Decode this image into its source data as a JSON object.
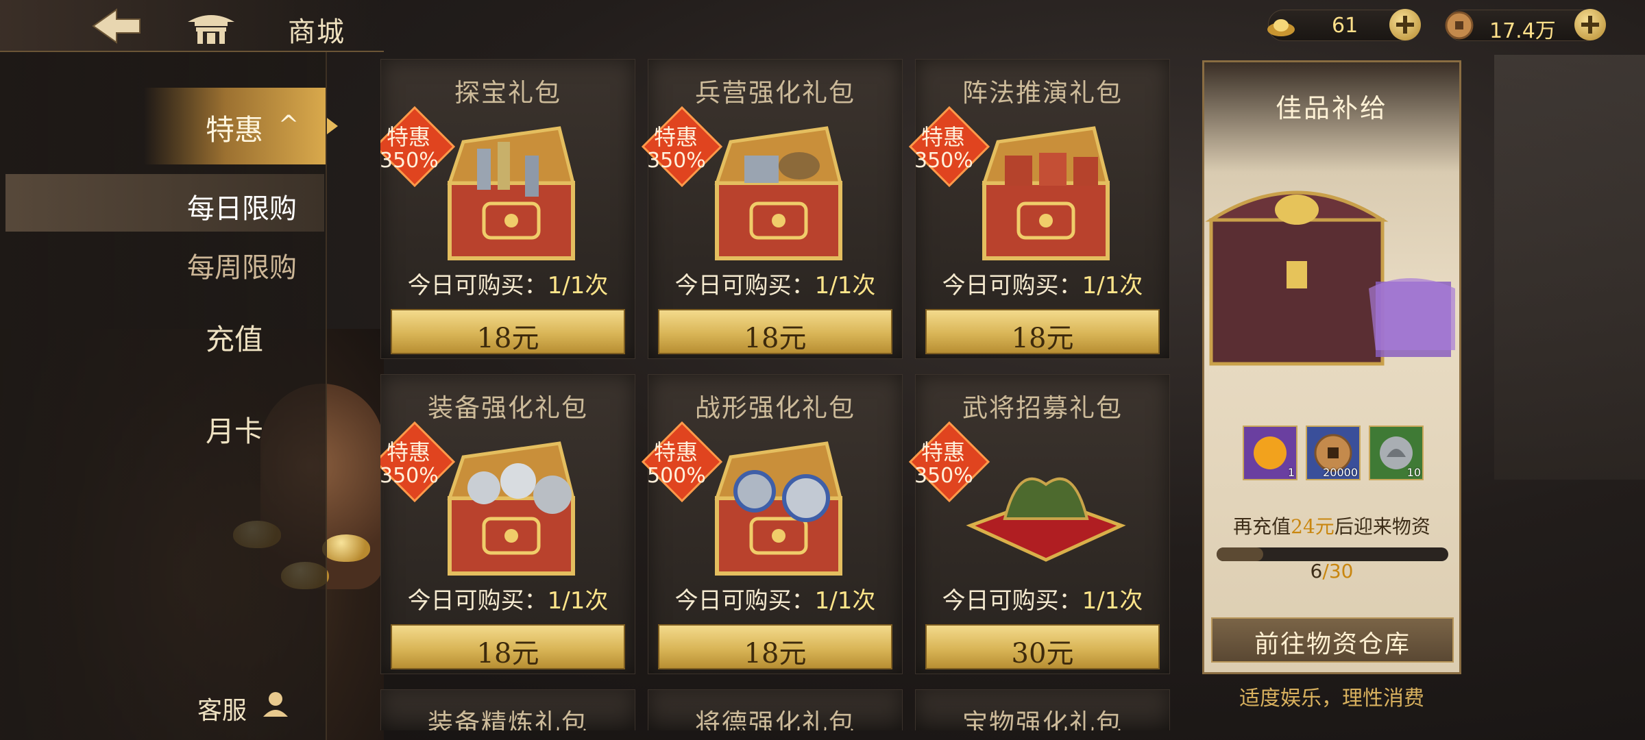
{
  "header": {
    "title": "商城",
    "gold_ingot": "61",
    "copper_coins": "17.4万"
  },
  "sidebar": {
    "category": "特惠",
    "category_chevron": "^",
    "subitems": [
      {
        "label": "每日限购",
        "active": true
      },
      {
        "label": "每周限购",
        "active": false
      }
    ],
    "items": [
      {
        "label": "充值"
      },
      {
        "label": "月卡"
      }
    ],
    "service": "客服"
  },
  "deal_tag": "特惠",
  "products": [
    {
      "name": "探宝礼包",
      "bonus": "350%",
      "limit_label": "今日可购买：",
      "limit_count": "1/1次",
      "price": "18元"
    },
    {
      "name": "兵营强化礼包",
      "bonus": "350%",
      "limit_label": "今日可购买：",
      "limit_count": "1/1次",
      "price": "18元"
    },
    {
      "name": "阵法推演礼包",
      "bonus": "350%",
      "limit_label": "今日可购买：",
      "limit_count": "1/1次",
      "price": "18元"
    },
    {
      "name": "装备强化礼包",
      "bonus": "350%",
      "limit_label": "今日可购买：",
      "limit_count": "1/1次",
      "price": "18元"
    },
    {
      "name": "战形强化礼包",
      "bonus": "500%",
      "limit_label": "今日可购买：",
      "limit_count": "1/1次",
      "price": "18元"
    },
    {
      "name": "武将招募礼包",
      "bonus": "350%",
      "limit_label": "今日可购买：",
      "limit_count": "1/1次",
      "price": "30元"
    }
  ],
  "products_partial": [
    {
      "name": "装备精炼礼包"
    },
    {
      "name": "将德强化礼包"
    },
    {
      "name": "宝物强化礼包"
    }
  ],
  "supply": {
    "title": "佳品补给",
    "rewards": [
      {
        "icon": "gold-orb-icon",
        "qty": "1"
      },
      {
        "icon": "copper-coin-icon",
        "qty": "20000"
      },
      {
        "icon": "silver-token-icon",
        "qty": "10"
      }
    ],
    "tip_prefix": "再充值",
    "tip_amount": "24元",
    "tip_suffix": "后迎来物资",
    "progress_current": "6",
    "progress_separator": "/",
    "progress_max": "30",
    "progress_fraction": 0.2,
    "button": "前往物资仓库"
  },
  "notice": "适度娱乐，理性消费",
  "colors": {
    "gold_button": "#d9b557",
    "badge_red": "#e0441f",
    "highlight": "#ffe58a",
    "panel": "#e9dcc4"
  }
}
